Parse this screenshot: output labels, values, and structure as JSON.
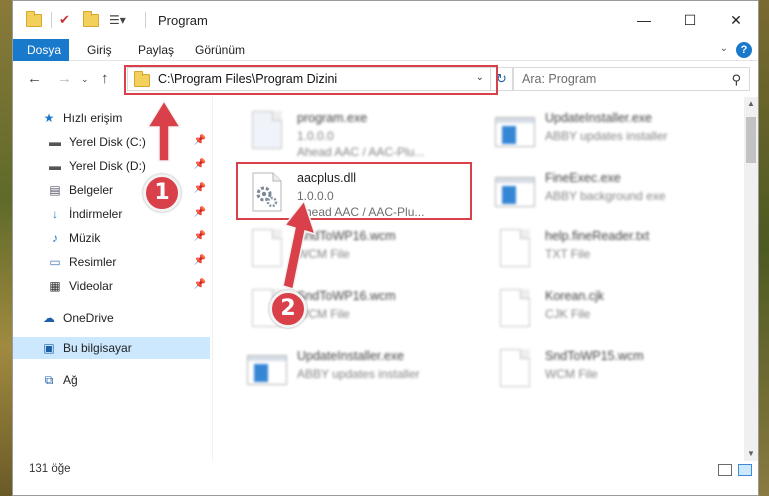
{
  "window": {
    "title": "Program",
    "controls": {
      "minimize": "—",
      "maximize": "☐",
      "close": "✕"
    }
  },
  "ribbon": {
    "tabs": [
      "Dosya",
      "Giriş",
      "Paylaş",
      "Görünüm"
    ],
    "active_tab": "Dosya",
    "help": "?"
  },
  "address": {
    "path": "C:\\Program Files\\Program Dizini",
    "search_placeholder": "Ara: Program"
  },
  "sidebar": {
    "items": [
      {
        "label": "Hızlı erişim",
        "icon": "star-icon",
        "pinned": false
      },
      {
        "label": "Yerel Disk (C:)",
        "icon": "drive-icon",
        "pinned": true
      },
      {
        "label": "Yerel Disk (D:)",
        "icon": "drive-icon",
        "pinned": true
      },
      {
        "label": "Belgeler",
        "icon": "documents-icon",
        "pinned": true
      },
      {
        "label": "İndirmeler",
        "icon": "download-icon",
        "pinned": true
      },
      {
        "label": "Müzik",
        "icon": "music-icon",
        "pinned": true
      },
      {
        "label": "Resimler",
        "icon": "pictures-icon",
        "pinned": true
      },
      {
        "label": "Videolar",
        "icon": "videos-icon",
        "pinned": true
      },
      {
        "label": "OneDrive",
        "icon": "cloud-icon",
        "pinned": false
      },
      {
        "label": "Bu bilgisayar",
        "icon": "computer-icon",
        "pinned": false,
        "selected": true
      },
      {
        "label": "Ağ",
        "icon": "network-icon",
        "pinned": false
      }
    ]
  },
  "files": [
    {
      "name": "program.exe",
      "line2": "1.0.0.0",
      "line3": "Ahead AAC / AAC-Plu...",
      "type": "exe",
      "blurred": true
    },
    {
      "name": "UpdateInstaller.exe",
      "line2": "ABBY updates installer",
      "line3": "",
      "type": "exe",
      "blurred": true
    },
    {
      "name": "aacplus.dll",
      "line2": "1.0.0.0",
      "line3": "Ahead AAC / AAC-Plu...",
      "type": "dll",
      "blurred": false
    },
    {
      "name": "FineExec.exe",
      "line2": "ABBY background exe",
      "line3": "",
      "type": "exe",
      "blurred": true
    },
    {
      "name": "SndToWP16.wcm",
      "line2": "WCM File",
      "line3": "",
      "type": "doc",
      "blurred": true
    },
    {
      "name": "help.fineReader.txt",
      "line2": "TXT File",
      "line3": "",
      "type": "doc",
      "blurred": true
    },
    {
      "name": "SndToWP16.wcm",
      "line2": "WCM File",
      "line3": "",
      "type": "doc",
      "blurred": true
    },
    {
      "name": "Korean.cjk",
      "line2": "CJK File",
      "line3": "",
      "type": "doc",
      "blurred": true
    },
    {
      "name": "UpdateInstaller.exe",
      "line2": "ABBY updates installer",
      "line3": "",
      "type": "exe",
      "blurred": true
    },
    {
      "name": "SndToWP15.wcm",
      "line2": "WCM File",
      "line3": "",
      "type": "doc",
      "blurred": true
    }
  ],
  "status": {
    "count": "131 öğe"
  },
  "annotations": {
    "badge1": "1",
    "badge2": "2",
    "color": "#d9404a"
  },
  "colors": {
    "accent": "#1979ca",
    "selection": "#cce8ff"
  }
}
